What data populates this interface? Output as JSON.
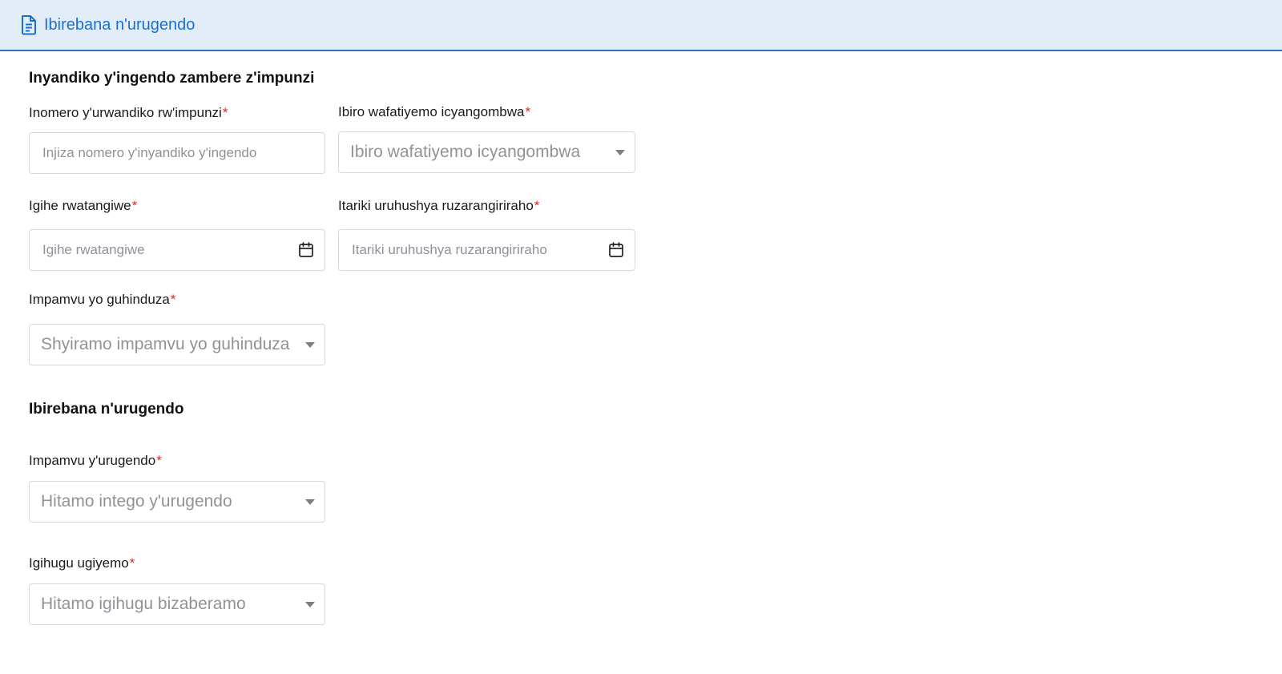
{
  "header": {
    "icon": "document-icon",
    "title": "Ibirebana n'urugendo"
  },
  "section1": {
    "title": "Inyandiko y'ingendo zambere z'impunzi",
    "fields": {
      "refugee_doc_number": {
        "label": "Inomero y'urwandiko rw'impunzi",
        "required": "*",
        "placeholder": "Injiza nomero y'inyandiko y'ingendo"
      },
      "issuing_office": {
        "label": "Ibiro wafatiyemo icyangombwa",
        "required": "*",
        "placeholder": "Ibiro wafatiyemo icyangombwa"
      },
      "issue_date": {
        "label": "Igihe rwatangiwe",
        "required": "*",
        "placeholder": "Igihe rwatangiwe"
      },
      "expiry_date": {
        "label": "Itariki uruhushya ruzarangiriraho",
        "required": "*",
        "placeholder": "Itariki uruhushya ruzarangiriraho"
      },
      "change_reason": {
        "label": "Impamvu yo guhinduza",
        "required": "*",
        "placeholder": "Shyiramo impamvu yo guhinduza"
      }
    }
  },
  "section2": {
    "title": "Ibirebana n'urugendo",
    "fields": {
      "travel_purpose": {
        "label": "Impamvu y'urugendo",
        "required": "*",
        "placeholder": "Hitamo intego y'urugendo"
      },
      "current_country": {
        "label": "Igihugu ugiyemo",
        "required": "*",
        "placeholder": "Hitamo igihugu bizaberamo"
      }
    }
  },
  "colors": {
    "accent": "#1d6fd1",
    "header_bg": "#e3edf8",
    "required": "#e0262b",
    "placeholder": "#8d9199",
    "border": "#d4d8de"
  }
}
